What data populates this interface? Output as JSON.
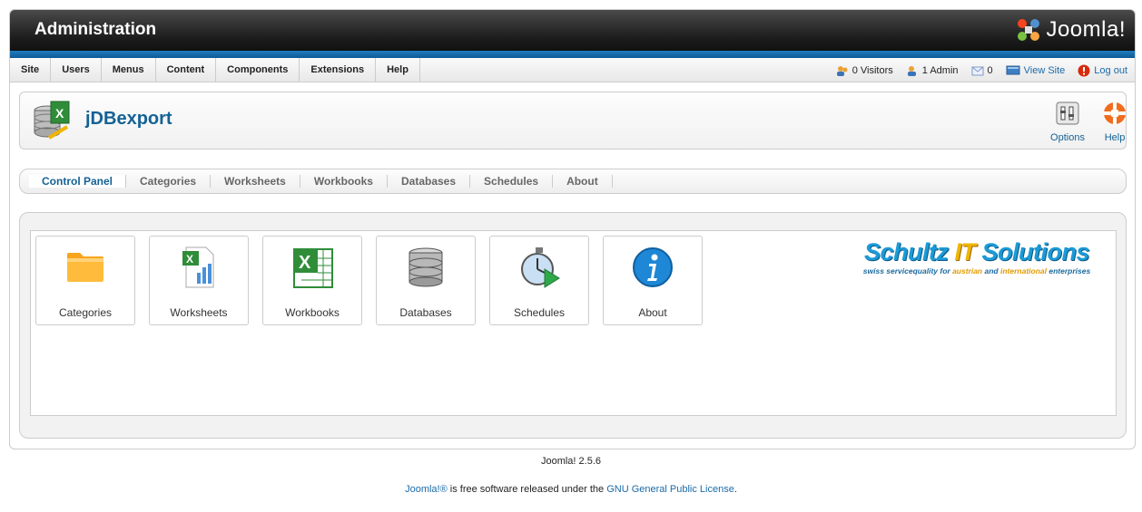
{
  "header": {
    "title": "Administration",
    "logo_text": "Joomla!"
  },
  "menu": {
    "items": [
      {
        "label": "Site"
      },
      {
        "label": "Users"
      },
      {
        "label": "Menus"
      },
      {
        "label": "Content"
      },
      {
        "label": "Components"
      },
      {
        "label": "Extensions"
      },
      {
        "label": "Help"
      }
    ]
  },
  "status": {
    "visitors": "0 Visitors",
    "admins": "1 Admin",
    "messages": "0",
    "view_site": "View Site",
    "logout": "Log out"
  },
  "toolbar": {
    "title": "jDBexport",
    "options_label": "Options",
    "help_label": "Help"
  },
  "submenu": {
    "items": [
      {
        "label": "Control Panel"
      },
      {
        "label": "Categories"
      },
      {
        "label": "Worksheets"
      },
      {
        "label": "Workbooks"
      },
      {
        "label": "Databases"
      },
      {
        "label": "Schedules"
      },
      {
        "label": "About"
      }
    ]
  },
  "tiles": [
    {
      "label": "Categories",
      "icon": "folder-icon"
    },
    {
      "label": "Worksheets",
      "icon": "worksheet-icon"
    },
    {
      "label": "Workbooks",
      "icon": "excel-icon"
    },
    {
      "label": "Databases",
      "icon": "database-icon"
    },
    {
      "label": "Schedules",
      "icon": "stopwatch-icon"
    },
    {
      "label": "About",
      "icon": "info-icon"
    }
  ],
  "brand": {
    "name_part1": "Schultz ",
    "name_part2": "IT",
    "name_part3": " Solutions",
    "tag_part1": "swiss servicequality for ",
    "tag_part2": "austrian",
    "tag_part3": " and ",
    "tag_part4": "international",
    "tag_part5": " enterprises"
  },
  "footer": {
    "version": "Joomla! 2.5.6",
    "license_link1": "Joomla!®",
    "license_text": " is free software released under the ",
    "license_link2": "GNU General Public License",
    "license_end": "."
  },
  "colors": {
    "accent_blue": "#146295",
    "header_bar": "#1a1a1a",
    "blue_bar": "#1f7dc1"
  }
}
